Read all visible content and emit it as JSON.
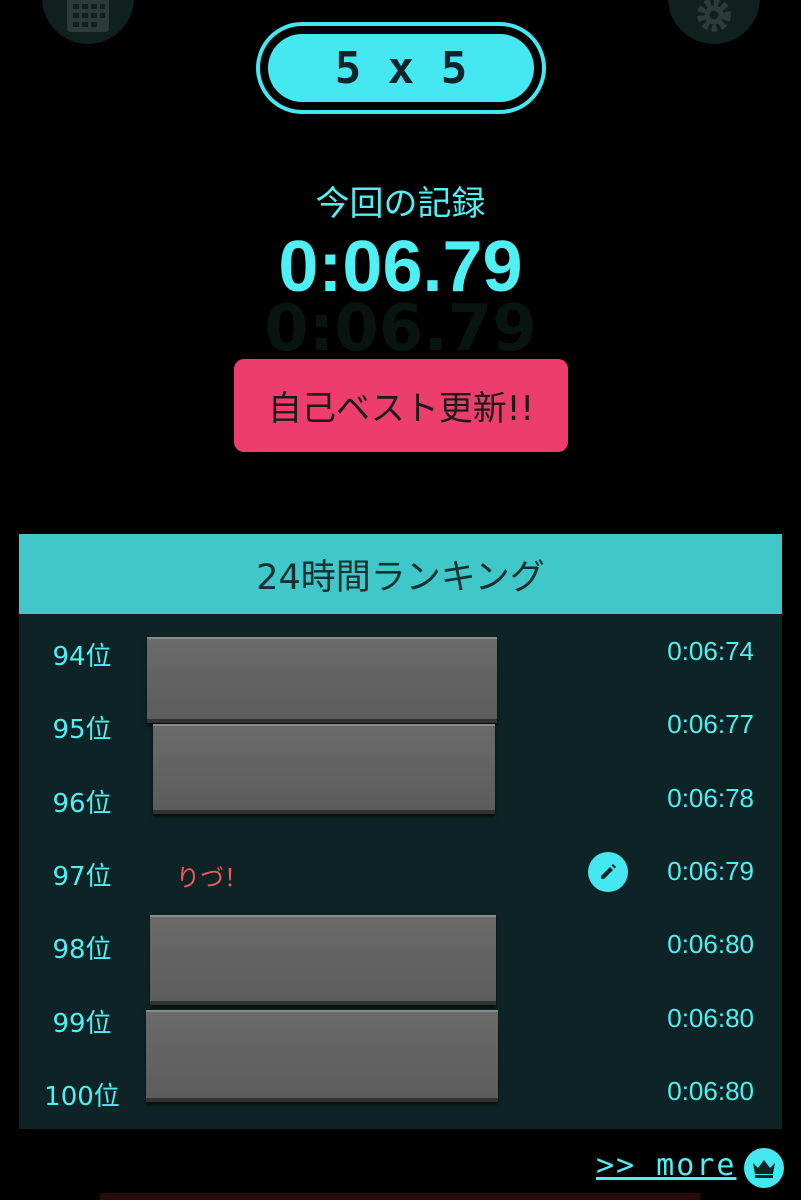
{
  "header": {
    "mode_label": "5 x 5",
    "icons": [
      "calendar-icon",
      "gear-icon"
    ]
  },
  "result": {
    "label": "今回の記録",
    "time": "0:06.79",
    "badge": "自己ベスト更新!!"
  },
  "ranking": {
    "title": "24時間ランキング",
    "rows": [
      {
        "rank": "94位",
        "name": "",
        "time": "0:06:74"
      },
      {
        "rank": "95位",
        "name": "",
        "time": "0:06:77"
      },
      {
        "rank": "96位",
        "name": "",
        "time": "0:06:78"
      },
      {
        "rank": "97位",
        "name": "りづ！",
        "time": "0:06:79"
      },
      {
        "rank": "98位",
        "name": "",
        "time": "0:06:80"
      },
      {
        "rank": "99位",
        "name": "",
        "time": "0:06:80"
      },
      {
        "rank": "100位",
        "name": "",
        "time": "0:06:80"
      }
    ]
  },
  "footer": {
    "more_label": ">> more"
  },
  "colors": {
    "accent": "#45e8f0",
    "badge": "#ec3d6c",
    "panel": "#0e2325",
    "panel_header": "#40c7c9",
    "player_name": "#ee5a5a"
  }
}
